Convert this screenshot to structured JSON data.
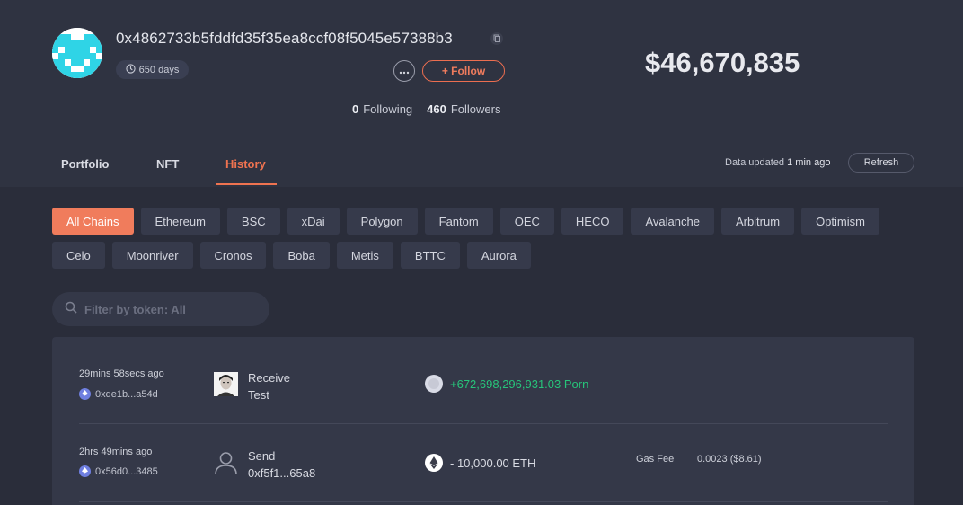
{
  "profile": {
    "address": "0x4862733b5fddfd35f35ea8ccf08f5045e57388b3",
    "days_label": "650 days",
    "balance": "$46,670,835",
    "follow_label": "+ Follow",
    "following_count": "0",
    "following_label": "Following",
    "followers_count": "460",
    "followers_label": "Followers"
  },
  "tabs": [
    {
      "label": "Portfolio",
      "active": false
    },
    {
      "label": "NFT",
      "active": false
    },
    {
      "label": "History",
      "active": true
    }
  ],
  "data_updated": {
    "prefix": "Data updated",
    "time": "1 min ago",
    "refresh_label": "Refresh"
  },
  "chains": {
    "row1": [
      "All Chains",
      "Ethereum",
      "BSC",
      "xDai",
      "Polygon",
      "Fantom",
      "OEC",
      "HECO",
      "Avalanche",
      "Arbitrum",
      "Optimism"
    ],
    "row2": [
      "Celo",
      "Moonriver",
      "Cronos",
      "Boba",
      "Metis",
      "BTTC",
      "Aurora"
    ],
    "active": "All Chains"
  },
  "filter": {
    "placeholder": "Filter by token: All"
  },
  "transactions": [
    {
      "time": "29mins 58secs ago",
      "hash": "0xde1b...a54d",
      "type": "Receive",
      "target": "Test",
      "amount": "+672,698,296,931.03 Porn",
      "direction": "in",
      "gas_label": "",
      "gas_value": ""
    },
    {
      "time": "2hrs 49mins ago",
      "hash": "0x56d0...3485",
      "type": "Send",
      "target": "0xf5f1...65a8",
      "amount": "- 10,000.00 ETH",
      "direction": "out",
      "gas_label": "Gas Fee",
      "gas_value": "0.0023 ($8.61)"
    }
  ],
  "colors": {
    "accent": "#f07c5c",
    "positive": "#27c47a",
    "background": "#2a2d3a",
    "header": "#2f3341",
    "chip": "#363a4b"
  },
  "icons": {
    "avatar": "pixel-avatar-icon",
    "clock": "clock-icon",
    "copy": "copy-icon",
    "more": "more-dots-icon",
    "search": "search-icon",
    "eth": "ethereum-icon",
    "user": "user-icon"
  }
}
